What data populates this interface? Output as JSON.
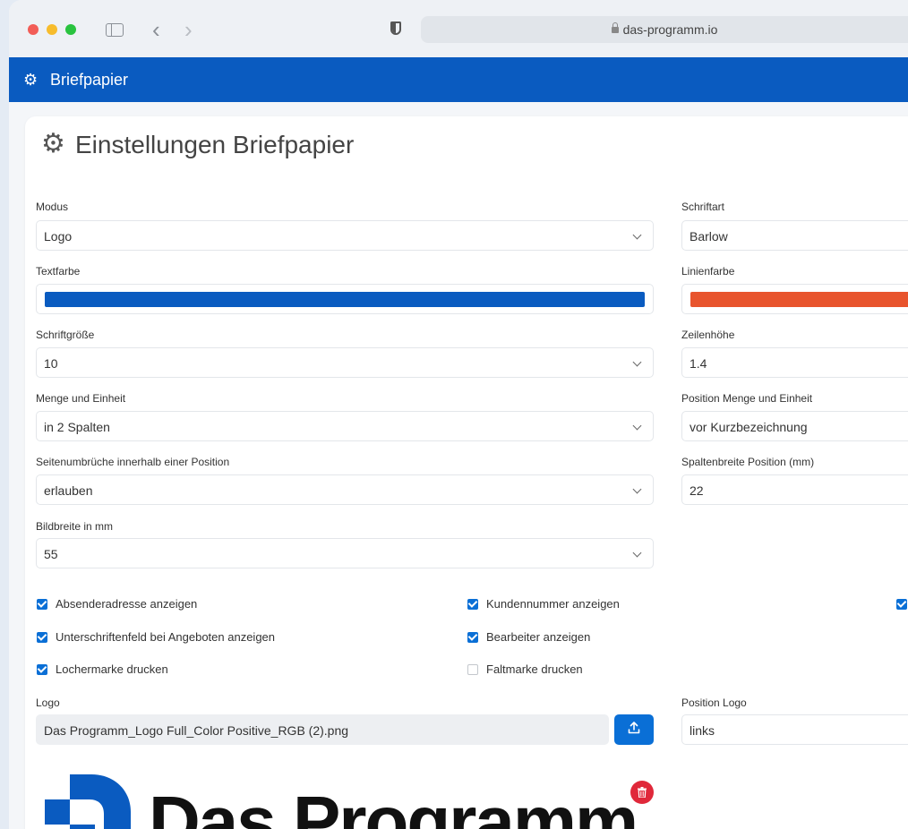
{
  "browser": {
    "url": "das-programm.io"
  },
  "appbar": {
    "title": "Briefpapier"
  },
  "page": {
    "title": "Einstellungen Briefpapier"
  },
  "fields": {
    "modus": {
      "label": "Modus",
      "value": "Logo"
    },
    "schriftart": {
      "label": "Schriftart",
      "value": "Barlow"
    },
    "textfarbe": {
      "label": "Textfarbe",
      "color": "#0a5bc0"
    },
    "linienfarbe": {
      "label": "Linienfarbe",
      "color": "#e8542d"
    },
    "schriftgroesse": {
      "label": "Schriftgröße",
      "value": "10"
    },
    "zeilenhoehe": {
      "label": "Zeilenhöhe",
      "value": "1.4"
    },
    "menge_einheit": {
      "label": "Menge und Einheit",
      "value": "in 2 Spalten"
    },
    "position_menge": {
      "label": "Position Menge und Einheit",
      "value": "vor Kurzbezeichnung"
    },
    "seitenumbrueche": {
      "label": "Seitenumbrüche innerhalb einer Position",
      "value": "erlauben"
    },
    "spaltenbreite": {
      "label": "Spaltenbreite Position (mm)",
      "value": "22"
    },
    "bildbreite": {
      "label": "Bildbreite in mm",
      "value": "55"
    },
    "logo": {
      "label": "Logo",
      "value": "Das Programm_Logo Full_Color Positive_RGB (2).png"
    },
    "position_logo": {
      "label": "Position Logo",
      "value": "links"
    }
  },
  "checkboxes": {
    "absender": {
      "label": "Absenderadresse anzeigen",
      "checked": true
    },
    "kundennummer": {
      "label": "Kundennummer anzeigen",
      "checked": true
    },
    "unterschrift": {
      "label": "Unterschriftenfeld bei Angeboten anzeigen",
      "checked": true
    },
    "bearbeiter": {
      "label": "Bearbeiter anzeigen",
      "checked": true
    },
    "lochermarke": {
      "label": "Lochermarke drucken",
      "checked": true
    },
    "faltmarke": {
      "label": "Faltmarke drucken",
      "checked": false
    },
    "third_column": {
      "label": "",
      "checked": true
    }
  },
  "logo_preview": {
    "text": "Das Programm"
  },
  "colors": {
    "brand": "#0a5bc0",
    "accent": "#0a6fd6",
    "danger": "#e0283a"
  }
}
